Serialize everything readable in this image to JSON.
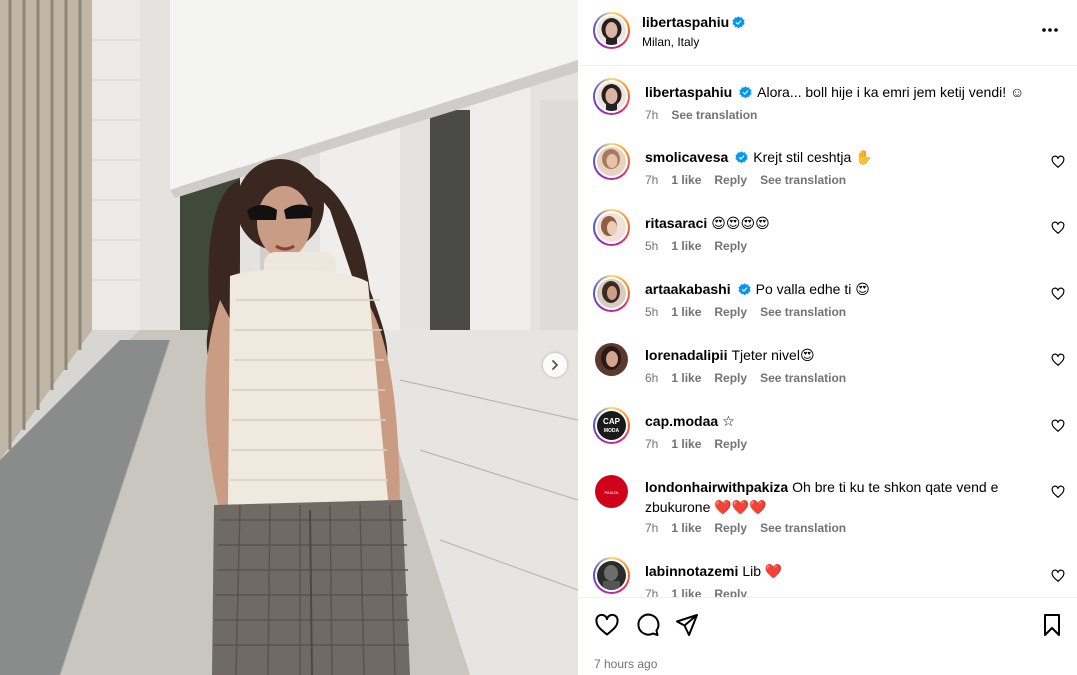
{
  "post": {
    "username": "libertaspahiu",
    "location": "Milan, Italy",
    "time_ago": "7 hours ago"
  },
  "caption": {
    "username": "libertaspahiu",
    "text": "Alora... boll hije i ka emri jem ketij vendi! ☺",
    "time": "7h",
    "see_translation": "See translation"
  },
  "comments": [
    {
      "username": "smolicavesa",
      "verified": true,
      "text": "Krejt stil ceshtja ✋",
      "time": "7h",
      "likes": "1 like",
      "reply": "Reply",
      "translation": "See translation"
    },
    {
      "username": "ritasaraci",
      "verified": false,
      "text": "😍😍😍😍",
      "time": "5h",
      "likes": "1 like",
      "reply": "Reply",
      "translation": ""
    },
    {
      "username": "artaakabashi",
      "verified": true,
      "text": "Po valla edhe ti 😍",
      "time": "5h",
      "likes": "1 like",
      "reply": "Reply",
      "translation": "See translation"
    },
    {
      "username": "lorenadalipii",
      "verified": false,
      "text": "Tjeter nivel😍",
      "time": "6h",
      "likes": "1 like",
      "reply": "Reply",
      "translation": "See translation"
    },
    {
      "username": "cap.modaa",
      "verified": false,
      "text": "☆",
      "time": "7h",
      "likes": "1 like",
      "reply": "Reply",
      "translation": ""
    },
    {
      "username": "londonhairwithpakiza",
      "verified": false,
      "text": "Oh bre ti ku te shkon qate vend e zbukurone ❤️❤️❤️",
      "time": "7h",
      "likes": "1 like",
      "reply": "Reply",
      "translation": "See translation"
    },
    {
      "username": "labinnotazemi",
      "verified": false,
      "text": "Lib ❤️",
      "time": "7h",
      "likes": "1 like",
      "reply": "Reply",
      "translation": ""
    }
  ],
  "avatar_labels": {
    "cap_modaa": "CAP MODA",
    "london": "PAKIZA"
  },
  "colors": {
    "verified": "#0095f6",
    "meta_text": "#737373",
    "divider": "#efefef"
  },
  "icons": [
    "verified-badge-icon",
    "more-options-icon",
    "heart-icon",
    "comment-icon",
    "share-icon",
    "bookmark-icon",
    "chevron-right-icon"
  ]
}
